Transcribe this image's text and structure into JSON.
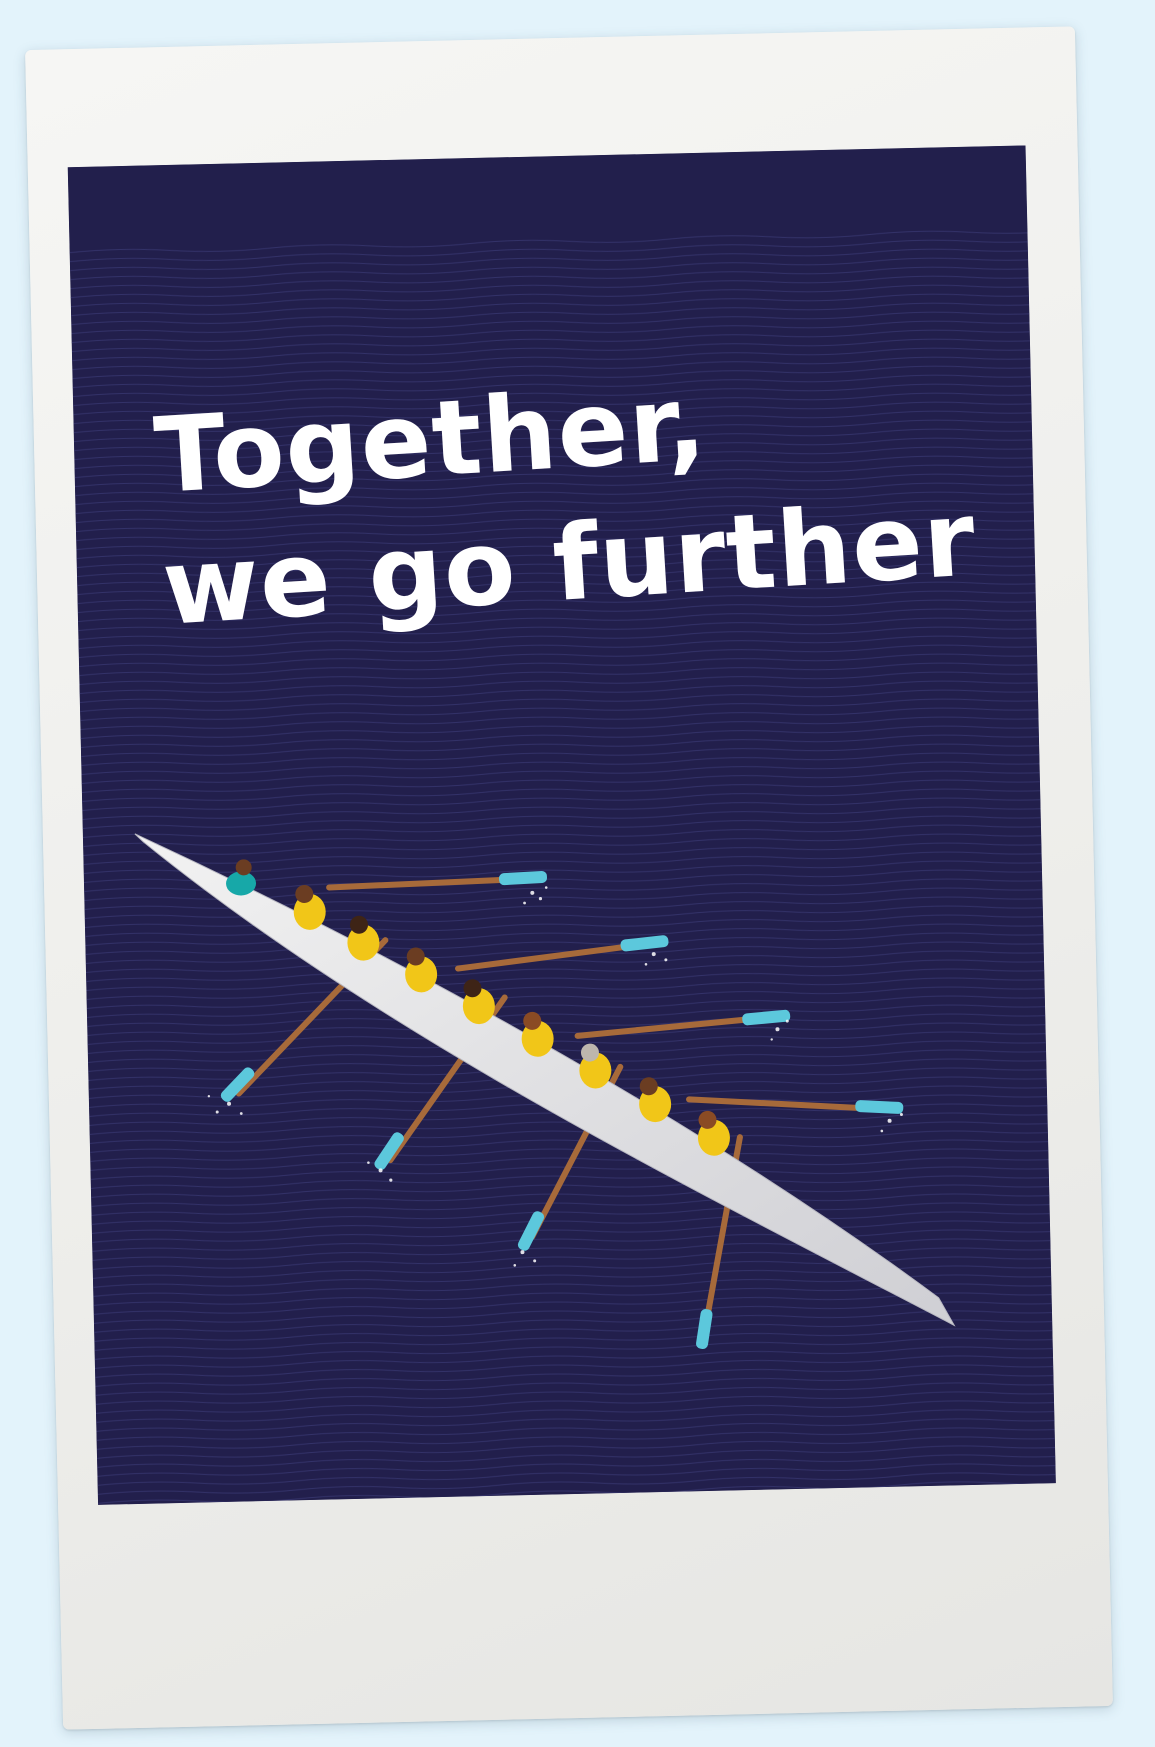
{
  "poster": {
    "headline_line1": "Together,",
    "headline_line2": "we go further"
  },
  "colors": {
    "background": "#e3f3fb",
    "frame": "#f2f2f0",
    "poster": "#221f4c",
    "wave_lines": "#3a3a74",
    "boat": "#e3e3e3",
    "rower_shirt": "#f1c618",
    "oar_shaft": "#a76a3a",
    "oar_blade": "#5cc8dc"
  },
  "illustration": {
    "subject": "rowing-eight-boat",
    "rowers": 8,
    "coxswain": 1
  }
}
